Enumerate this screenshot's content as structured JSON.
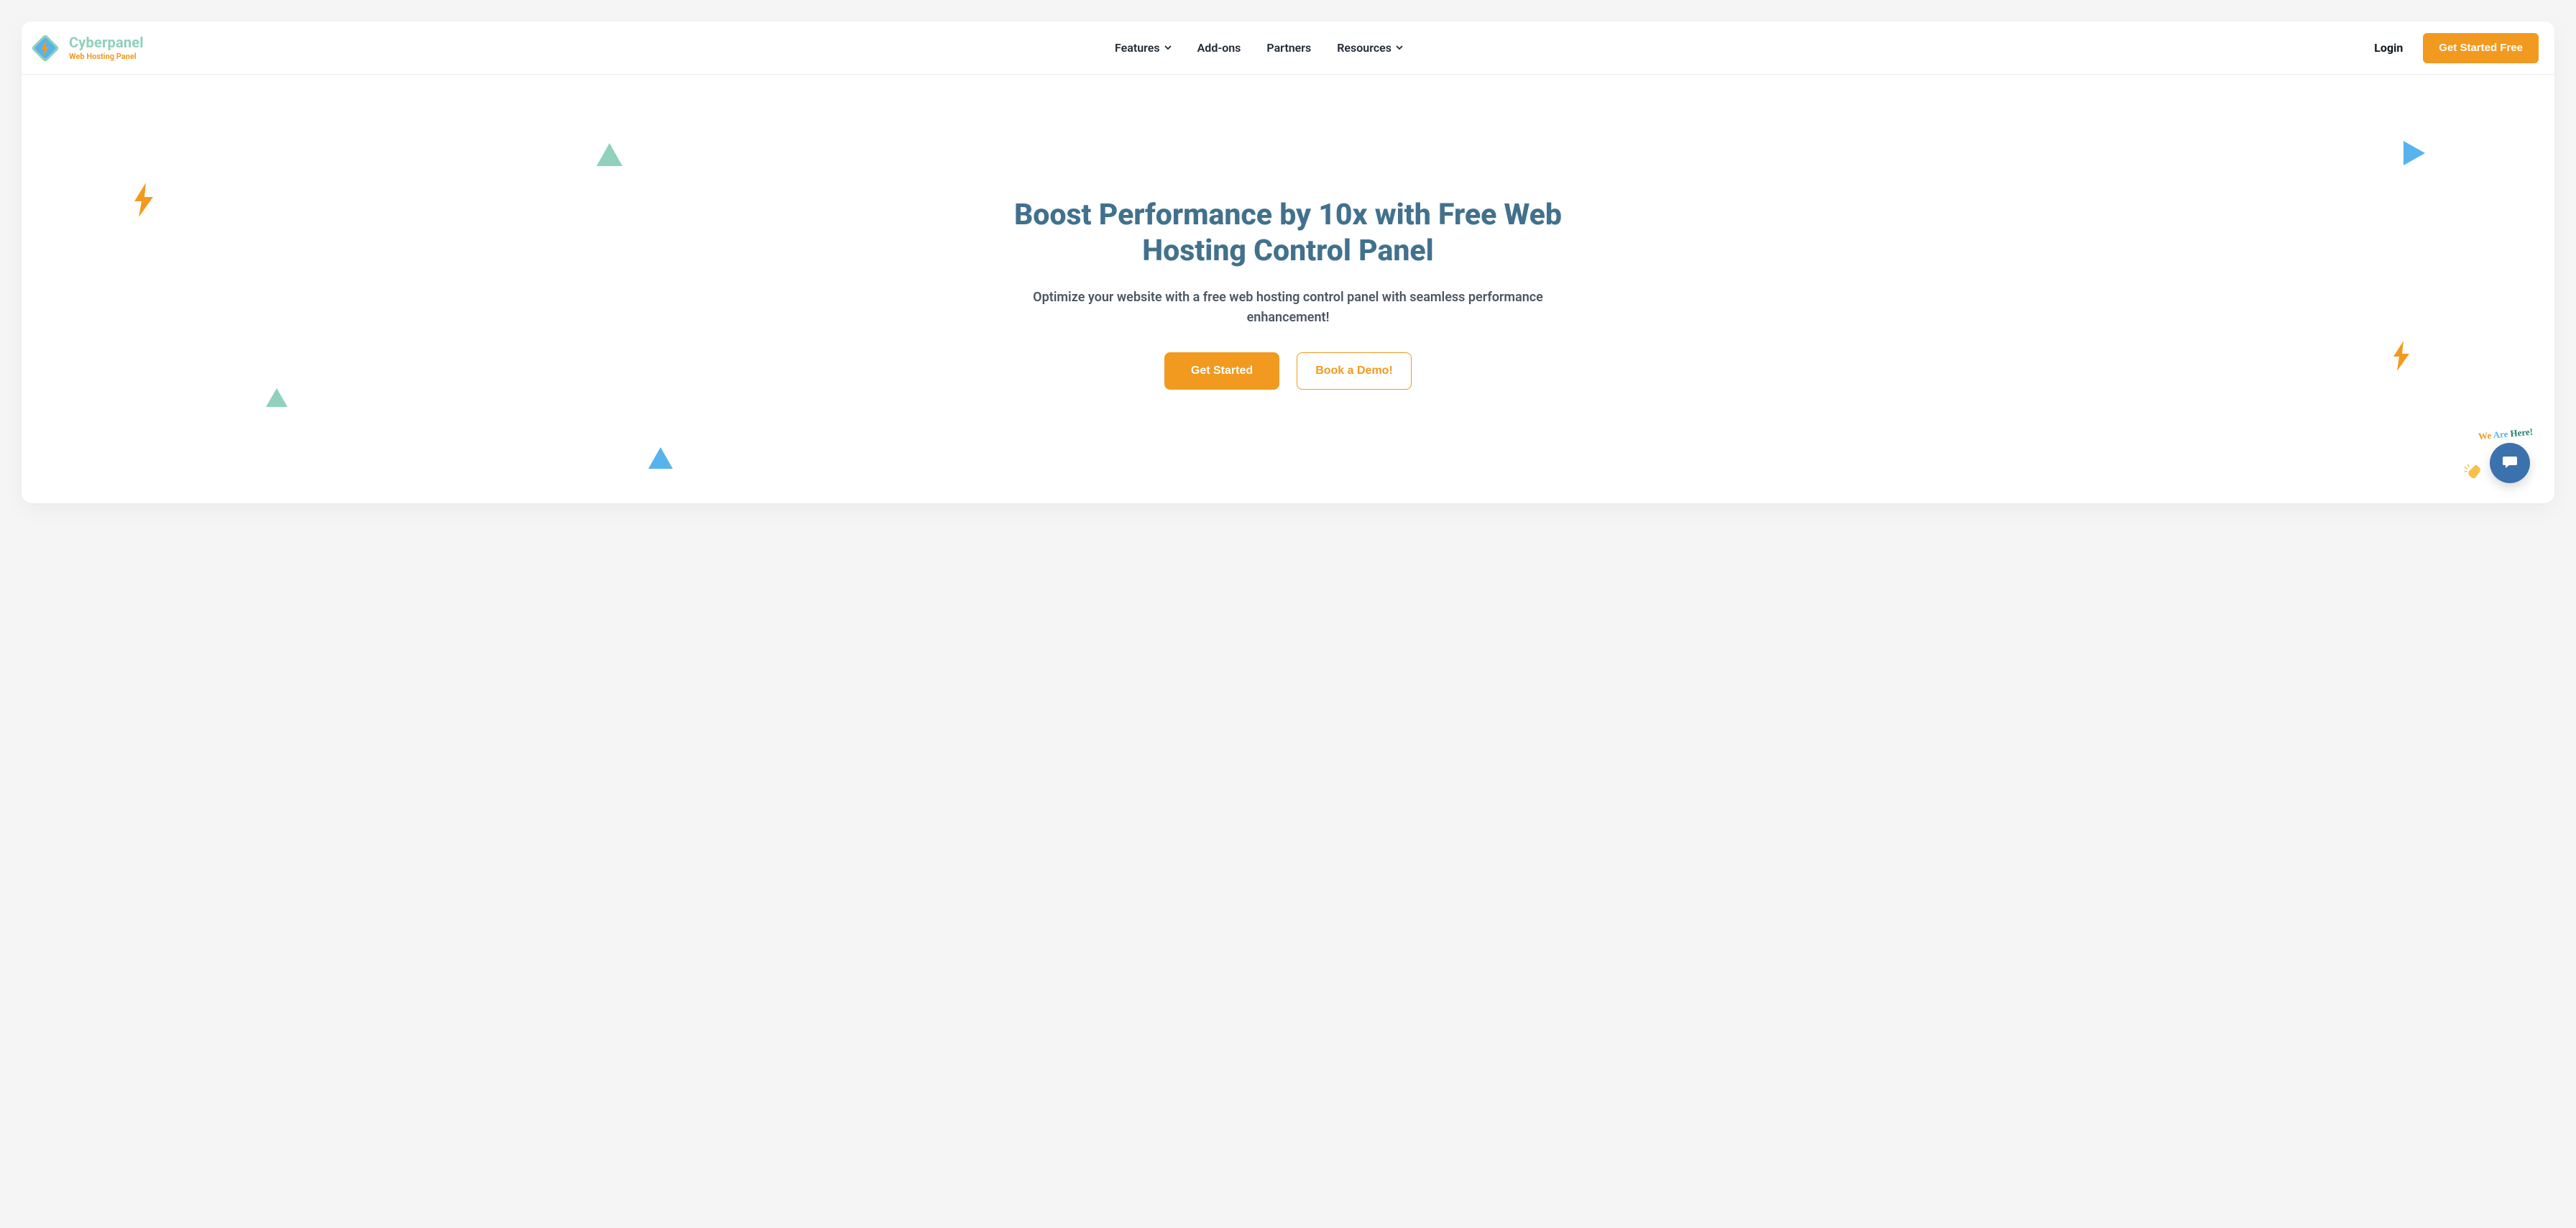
{
  "brand": {
    "title": "Cyberpanel",
    "subtitle": "Web Hosting Panel"
  },
  "nav": {
    "items": [
      {
        "label": "Features",
        "has_dropdown": true
      },
      {
        "label": "Add-ons",
        "has_dropdown": false
      },
      {
        "label": "Partners",
        "has_dropdown": false
      },
      {
        "label": "Resources",
        "has_dropdown": true
      }
    ],
    "login_label": "Login",
    "cta_label": "Get Started Free"
  },
  "hero": {
    "title": "Boost Performance by 10x with Free Web Hosting Control Panel",
    "subtitle": "Optimize your website with a free web hosting control panel with seamless performance enhancement!",
    "primary_cta": "Get Started",
    "secondary_cta": "Book a Demo!"
  },
  "chat": {
    "here_label_words": [
      "We",
      "Are",
      "Here!"
    ]
  },
  "colors": {
    "accent_orange": "#f19a1f",
    "accent_mint": "#8fd1bb",
    "accent_blue": "#57b3ec",
    "headline_teal": "#41718c",
    "fab_blue": "#3b72ad"
  }
}
